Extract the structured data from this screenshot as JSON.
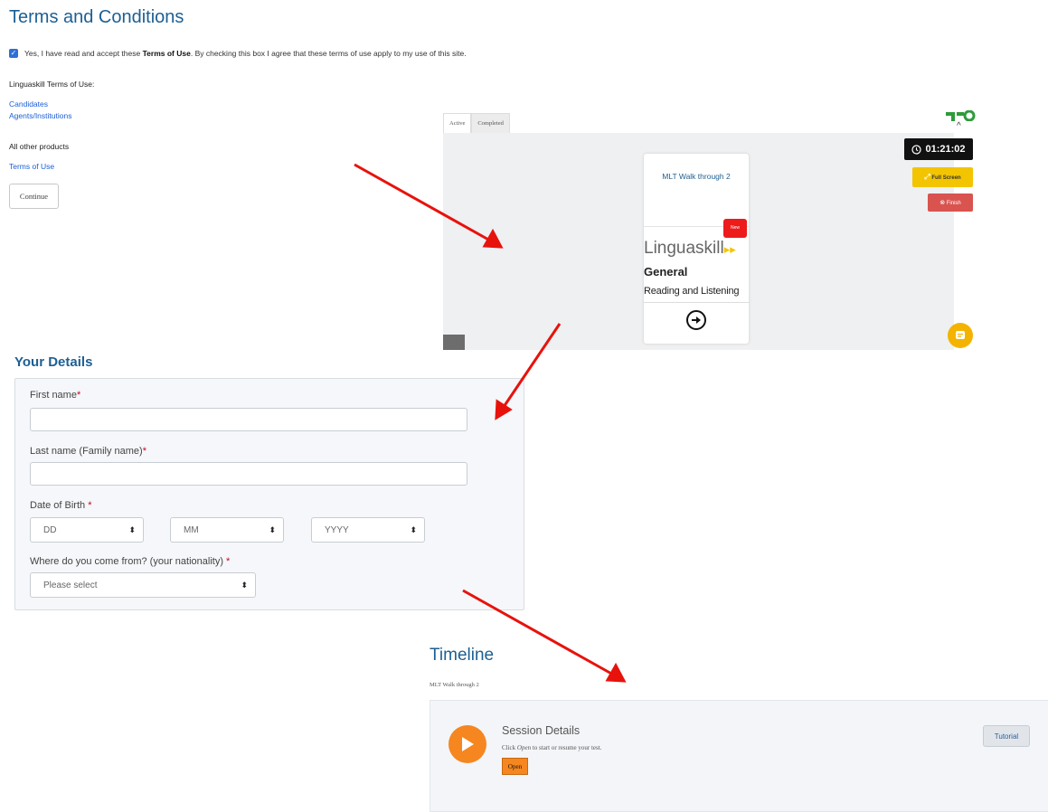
{
  "terms": {
    "title": "Terms and Conditions",
    "checkbox_checked": true,
    "accept_prefix": "Yes, I have read and accept these ",
    "accept_bold": "Terms of Use",
    "accept_suffix": ". By checking this box I agree that these terms of use apply to my use of this site.",
    "linguaskill_heading": "Linguaskill Terms of Use:",
    "links": [
      "Candidates",
      "Agents/Institutions"
    ],
    "other_heading": "All other products",
    "other_link": "Terms of Use",
    "continue_label": "Continue"
  },
  "app": {
    "tabs": [
      "Active",
      "Completed"
    ],
    "timer": "01:21:02",
    "fullscreen_label": "Full Screen",
    "finish_label": "Finish",
    "card": {
      "title": "MLT Walk through 2",
      "badge": "New",
      "brand": "Linguaskill",
      "level": "General",
      "subject": "Reading and Listening"
    },
    "colors": {
      "timer_bg": "#111111",
      "fullscreen": "#f3c400",
      "finish": "#d9534f",
      "badge": "#ee1b1b"
    }
  },
  "details": {
    "title": "Your Details",
    "first_name_label": "First name",
    "last_name_label": "Last name (Family name)",
    "dob_label": "Date of Birth ",
    "dob_day": "DD",
    "dob_month": "MM",
    "dob_year": "YYYY",
    "nationality_label": "Where do you come from? (your nationality) ",
    "nationality_value": "Please select",
    "required_mark": "*"
  },
  "timeline": {
    "title": "Timeline",
    "subtitle": "MLT Walk through 2",
    "session_title": "Session Details",
    "hint_prefix": "Click ",
    "hint_em": "Open",
    "hint_suffix": " to start or resume your test.",
    "open_label": "Open",
    "tutorial_label": "Tutorial",
    "accent": "#f6861f"
  },
  "annotation_color": "#e8120c"
}
